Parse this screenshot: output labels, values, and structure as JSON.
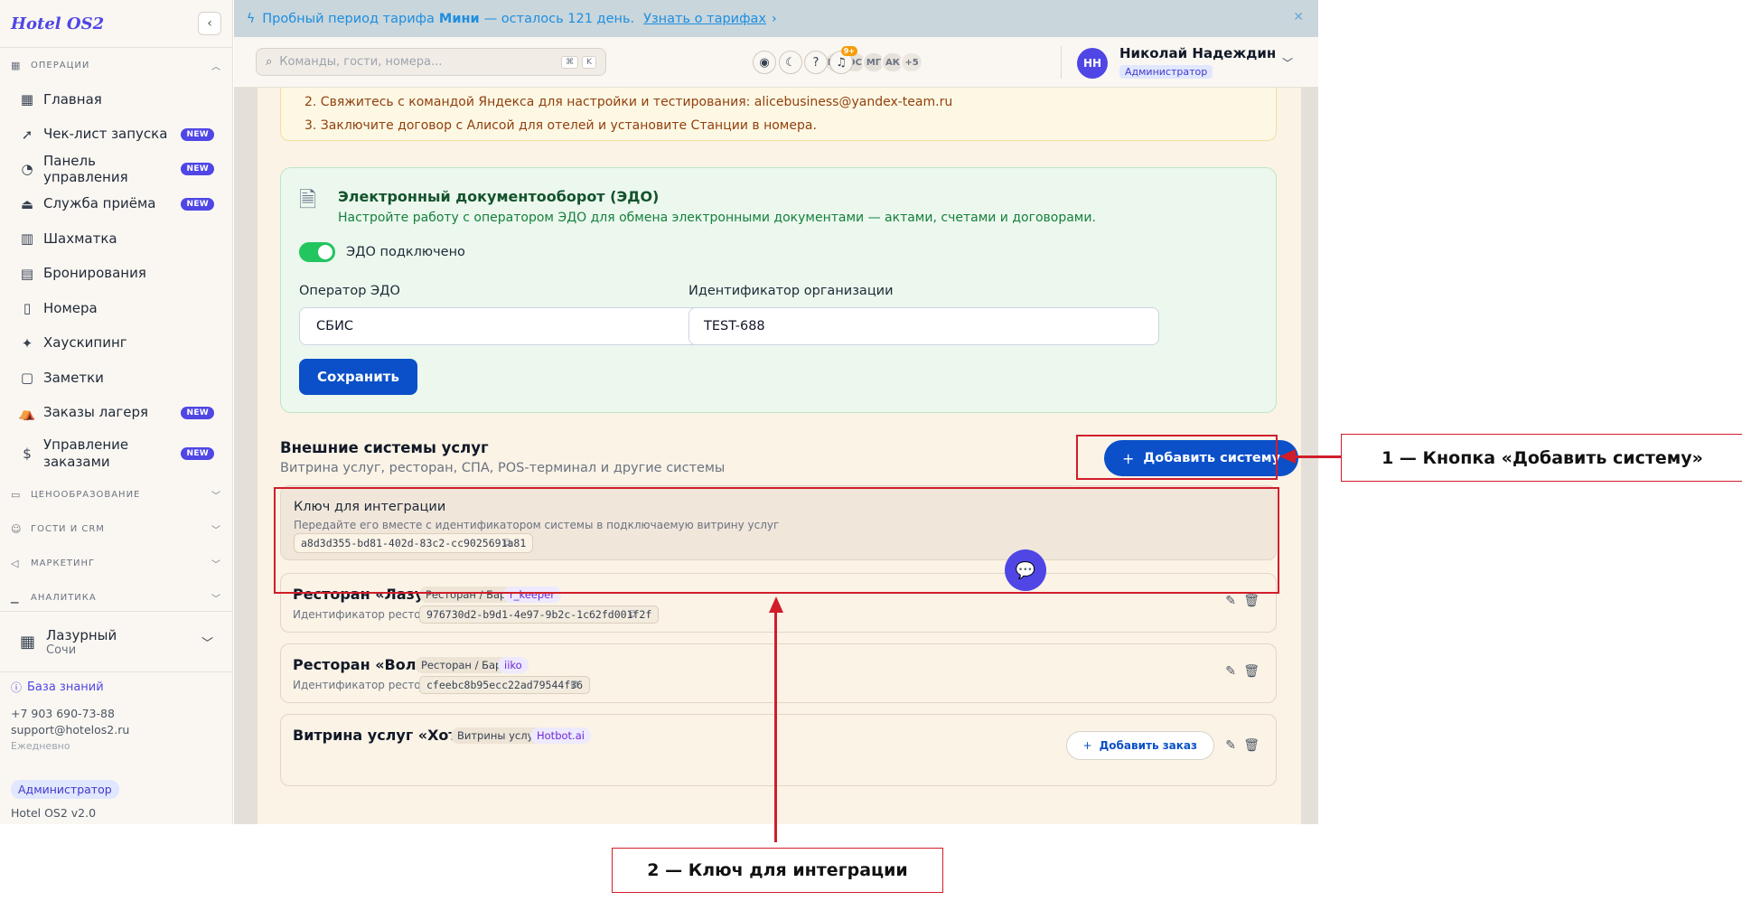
{
  "app": {
    "logo": "Hotel OS2"
  },
  "sidebar": {
    "groups": [
      {
        "label": "Операции"
      },
      {
        "label": "Ценообразование"
      },
      {
        "label": "Гости и CRM"
      },
      {
        "label": "Маркетинг"
      },
      {
        "label": "Аналитика"
      }
    ],
    "items": [
      {
        "label": "Главная",
        "icon": "grid-icon"
      },
      {
        "label": "Чек-лист запуска",
        "icon": "rocket-icon",
        "badge": "NEW"
      },
      {
        "label": "Панель управления",
        "icon": "gauge-icon",
        "badge": "NEW"
      },
      {
        "label": "Служба приёма",
        "icon": "bell-desk-icon",
        "badge": "NEW"
      },
      {
        "label": "Шахматка",
        "icon": "table-icon"
      },
      {
        "label": "Бронирования",
        "icon": "clipboard-icon"
      },
      {
        "label": "Номера",
        "icon": "door-icon"
      },
      {
        "label": "Хаускипинг",
        "icon": "sparkle-icon"
      },
      {
        "label": "Заметки",
        "icon": "note-icon"
      },
      {
        "label": "Заказы лагеря",
        "icon": "tent-icon",
        "badge": "NEW"
      },
      {
        "label": "Управление заказами",
        "icon": "receipt-icon",
        "badge": "NEW"
      }
    ],
    "hotel": {
      "name": "Лазурный",
      "city": "Сочи"
    },
    "footer": {
      "knowledge_base": "База знаний",
      "phone": "+7 903 690-73-88",
      "email": "support@hotelos2.ru",
      "hours": "Ежедневно",
      "role": "Администратор",
      "version": "Hotel OS2 v2.0"
    }
  },
  "banner": {
    "text_before": "Пробный период тарифа",
    "plan": "Мини",
    "text_after": "— осталось 121 день.",
    "link": "Узнать о тарифах",
    "link_chevron": "›",
    "color": "#1d8ee0"
  },
  "topbar": {
    "search_placeholder": "Команды, гости, номера...",
    "search_kbd": [
      "⌘",
      "K"
    ],
    "avatars": [
      "МИ",
      "ОС",
      "МГ",
      "АК",
      "+5"
    ],
    "notifications": "9+",
    "user": {
      "initials": "НН",
      "name": "Николай Надеждин",
      "role": "Администратор"
    }
  },
  "alice": {
    "lines": [
      "2. Свяжитесь с командой Яндекса для настройки и тестирования: alicebusiness@yandex-team.ru",
      "3. Заключите договор с Алисой для отелей и установите Станции в номера."
    ]
  },
  "edo": {
    "title": "Электронный документооборот (ЭДО)",
    "description": "Настройте работу с оператором ЭДО для обмена электронными документами — актами, счетами и договорами.",
    "toggle_label": "ЭДО подключено",
    "toggle_on": true,
    "operator_label": "Оператор ЭДО",
    "operator_value": "СБИС",
    "org_id_label": "Идентификатор организации",
    "org_id_value": "TEST-688",
    "save_label": "Сохранить"
  },
  "external": {
    "title": "Внешние системы услуг",
    "subtitle": "Витрина услуг, ресторан, СПА, POS-терминал и другие системы",
    "add_button": "Добавить систему",
    "integration_key": {
      "title": "Ключ для интеграции",
      "description": "Передайте его вместе с идентификатором системы в подключаемую витрину услуг",
      "value": "a8d3d355-bd81-402d-83c2-cc9025691a81"
    },
    "systems": [
      {
        "name": "Ресторан «Лазурь»",
        "type": "Ресторан / Бар",
        "provider": "r_keeper",
        "id_label": "Идентификатор ресторана:",
        "id": "976730d2-b9d1-4e97-9b2c-1c62fd001f2f"
      },
      {
        "name": "Ресторан «Волна»",
        "type": "Ресторан / Бар",
        "provider": "iiko",
        "id_label": "Идентификатор ресторана:",
        "id": "cfeebc8b95ecc22ad79544f36"
      },
      {
        "name": "Витрина услуг «Хотбот»",
        "type": "Витрины услуг",
        "provider": "Hotbot.ai",
        "add_order": "Добавить заказ"
      }
    ]
  },
  "annotations": {
    "callout_1": "1 — Кнопка «Добавить систему»",
    "callout_2": "2 — Ключ для интеграции",
    "color": "#d11d2a"
  }
}
